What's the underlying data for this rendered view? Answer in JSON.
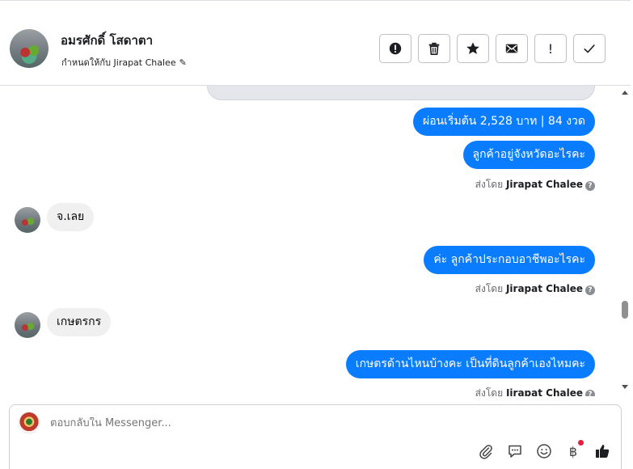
{
  "header": {
    "contact_name": "อมรศักดิ์ โสดาตา",
    "assigned_to_label": "กำหนดให้กับ Jirapat Chalee",
    "actions": [
      {
        "name": "report-icon"
      },
      {
        "name": "trash-icon"
      },
      {
        "name": "star-icon"
      },
      {
        "name": "mail-icon"
      },
      {
        "name": "exclamation-icon"
      },
      {
        "name": "check-icon"
      }
    ],
    "action_glyphs": {
      "exclamation": "!"
    }
  },
  "messages": {
    "m1": "ผ่อนเริ่มต้น 2,528 บาท | 84 งวด",
    "m2": "ลูกค้าอยู่จังหวัดอะไรคะ",
    "m3": "จ.เลย",
    "m4": "ค่ะ ลูกค้าประกอบอาชีพอะไรคะ",
    "m5": "เกษตรกร",
    "m6": "เกษตรด้านไหนบ้างคะ  เป็นที่ดินลูกค้าเองไหมคะ"
  },
  "sent_by": {
    "prefix": "ส่งโดย",
    "agent": "Jirapat Chalee",
    "help_glyph": "?"
  },
  "composer": {
    "placeholder": "ตอบกลับใน Messenger...",
    "icons": [
      "paperclip-icon",
      "chat-icon",
      "emoji-icon",
      "baht-icon",
      "thumbs-up-icon"
    ],
    "baht_glyph": "฿"
  },
  "colors": {
    "accent": "#0a7cff",
    "incoming_bubble": "#f0f0f0",
    "notification_dot": "#e41e3f"
  }
}
